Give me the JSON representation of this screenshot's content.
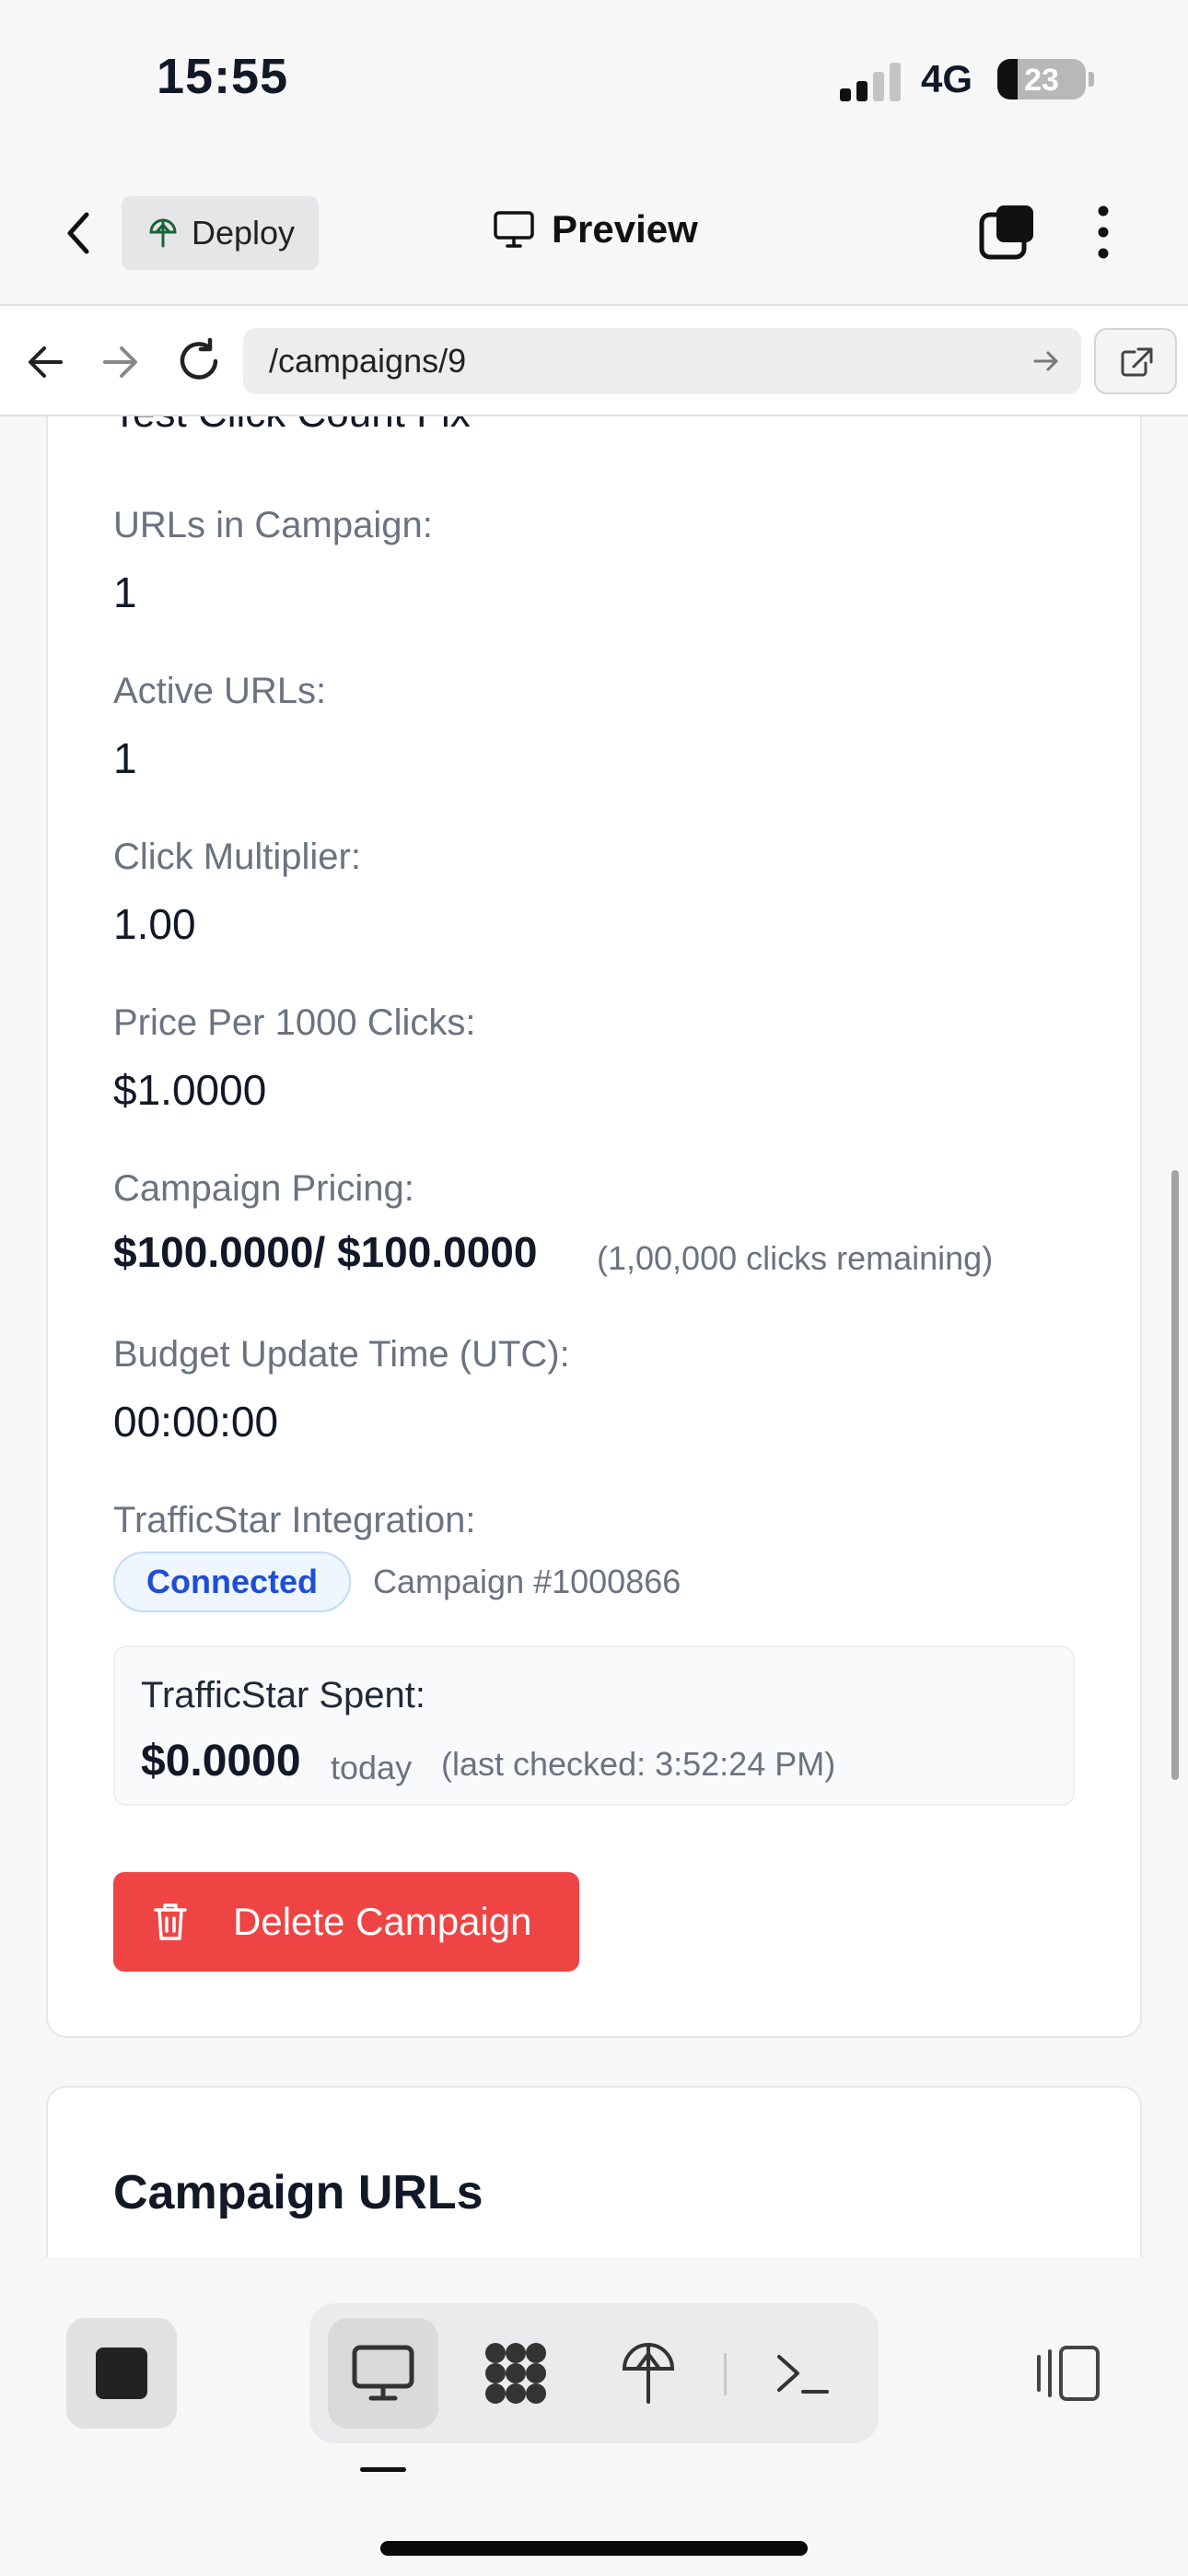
{
  "status_bar": {
    "time": "15:55",
    "network": "4G",
    "battery_percent": "23",
    "battery_level": 0.23
  },
  "header": {
    "deploy_label": "Deploy",
    "title": "Preview"
  },
  "urlbar": {
    "address": "/campaigns/9"
  },
  "campaign": {
    "name_partial": "Test Click Count Fix",
    "urls_label": "URLs in Campaign:",
    "urls_value": "1",
    "active_label": "Active URLs:",
    "active_value": "1",
    "multiplier_label": "Click Multiplier:",
    "multiplier_value": "1.00",
    "price_label": "Price Per 1000 Clicks:",
    "price_value": "$1.0000",
    "pricing_label": "Campaign Pricing:",
    "pricing_value": "$100.0000/ $100.0000",
    "pricing_note": "(1,00,000 clicks remaining)",
    "budget_time_label": "Budget Update Time (UTC):",
    "budget_time_value": "00:00:00",
    "integration_label": "TrafficStar Integration:",
    "integration_status": "Connected",
    "integration_campaign": "Campaign #1000866",
    "spent_label": "TrafficStar Spent:",
    "spent_amount": "$0.0000",
    "spent_period": "today",
    "spent_checked": "(last checked: 3:52:24 PM)",
    "delete_label": "Delete Campaign"
  },
  "urls_section": {
    "title": "Campaign URLs"
  },
  "colors": {
    "danger": "#ef4444",
    "badge_text": "#1d4ed8",
    "badge_bg": "#eff6ff",
    "label_gray": "#6b7280"
  },
  "toolbar": {
    "icons": [
      "stop-icon",
      "desktop-icon",
      "grid-apps-icon",
      "deploy-icon",
      "terminal-icon",
      "panel-icon"
    ],
    "active_tool": "desktop-icon"
  }
}
